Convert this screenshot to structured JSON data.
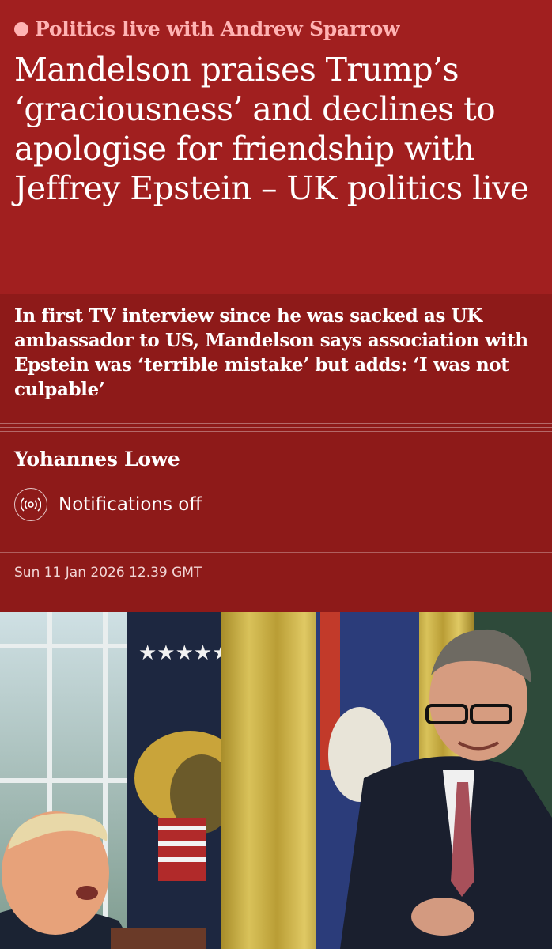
{
  "article": {
    "kicker": "Politics live with Andrew Sparrow",
    "headline": "Mandelson praises Trump’s ‘graciousness’ and declines to apologise for friendship with Jeffrey Epstein – UK politics live",
    "standfirst": "In first TV interview since he was sacked as UK ambassador to US, Mandelson says association with Epstein was ‘terrible mistake’ but adds: ‘I was not culpable’",
    "byline": "Yohannes Lowe",
    "notifications_label": "Notifications off",
    "dateline": "Sun 11 Jan 2026 12.39 GMT"
  },
  "colors": {
    "header_bg": "#a11f1f",
    "body_bg": "#8e1a19",
    "kicker_pink": "#ffb3b3"
  },
  "icons": {
    "live": "live-dot-icon",
    "notifications": "broadcast-icon"
  }
}
